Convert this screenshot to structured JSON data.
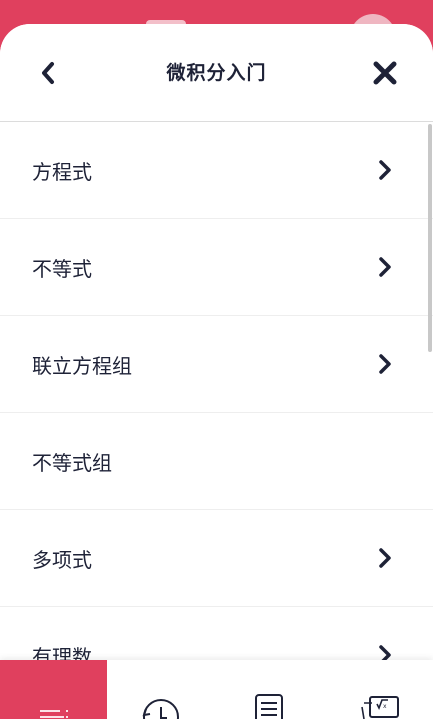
{
  "header": {
    "title": "微积分入门",
    "back_icon": "chevron-left-icon",
    "close_icon": "close-icon"
  },
  "list": {
    "items": [
      {
        "label": "方程式",
        "has_chevron": true
      },
      {
        "label": "不等式",
        "has_chevron": true
      },
      {
        "label": "联立方程组",
        "has_chevron": true
      },
      {
        "label": "不等式组",
        "has_chevron": false
      },
      {
        "label": "多项式",
        "has_chevron": true
      },
      {
        "label": "有理数",
        "has_chevron": true
      }
    ]
  },
  "bottom_nav": {
    "tabs": [
      {
        "icon": "menu-icon",
        "active": true
      },
      {
        "icon": "history-icon",
        "active": false
      },
      {
        "icon": "notes-icon",
        "active": false
      },
      {
        "icon": "math-input-icon",
        "active": false
      }
    ]
  },
  "colors": {
    "accent": "#e0405e",
    "text": "#1e2237"
  }
}
